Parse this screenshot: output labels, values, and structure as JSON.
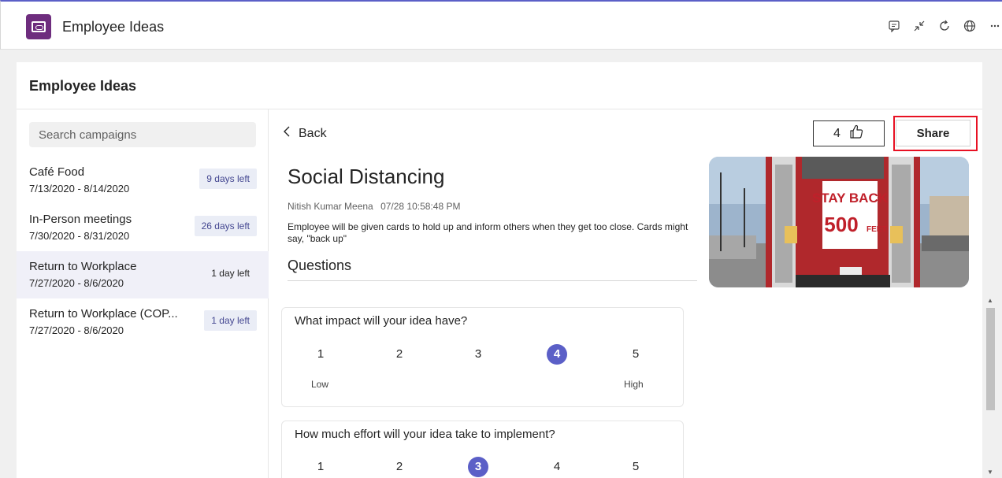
{
  "app": {
    "title": "Employee Ideas"
  },
  "panel": {
    "title": "Employee Ideas"
  },
  "search": {
    "placeholder": "Search campaigns"
  },
  "campaigns": [
    {
      "name": "Café Food",
      "dates": "7/13/2020 - 8/14/2020",
      "badge": "9 days left",
      "selected": false
    },
    {
      "name": "In-Person meetings",
      "dates": "7/30/2020 - 8/31/2020",
      "badge": "26 days left",
      "selected": false
    },
    {
      "name": "Return to Workplace",
      "dates": "7/27/2020 - 8/6/2020",
      "badge": "1 day left",
      "selected": true
    },
    {
      "name": "Return to Workplace (COP...",
      "dates": "7/27/2020 - 8/6/2020",
      "badge": "1 day left",
      "selected": false
    }
  ],
  "detail": {
    "back_label": "Back",
    "like_count": "4",
    "share_label": "Share",
    "title": "Social Distancing",
    "author": "Nitish Kumar Meena",
    "timestamp": "07/28 10:58:48 PM",
    "description": "Employee will be given cards to hold up and inform others when they get too close. Cards might say, \"back up\"",
    "questions_title": "Questions",
    "image_sign": {
      "line1": "STAY BACK",
      "line2": "500",
      "line3": "FEET"
    }
  },
  "questions": [
    {
      "text": "What impact will your idea have?",
      "options": [
        "1",
        "2",
        "3",
        "4",
        "5"
      ],
      "selected": 4,
      "low_label": "Low",
      "high_label": "High"
    },
    {
      "text": "How much effort will your idea take to implement?",
      "options": [
        "1",
        "2",
        "3",
        "4",
        "5"
      ],
      "selected": 3
    }
  ],
  "colors": {
    "accent": "#5b5fc7",
    "highlight_border": "#e81123",
    "app_icon": "#6e2d7e"
  }
}
